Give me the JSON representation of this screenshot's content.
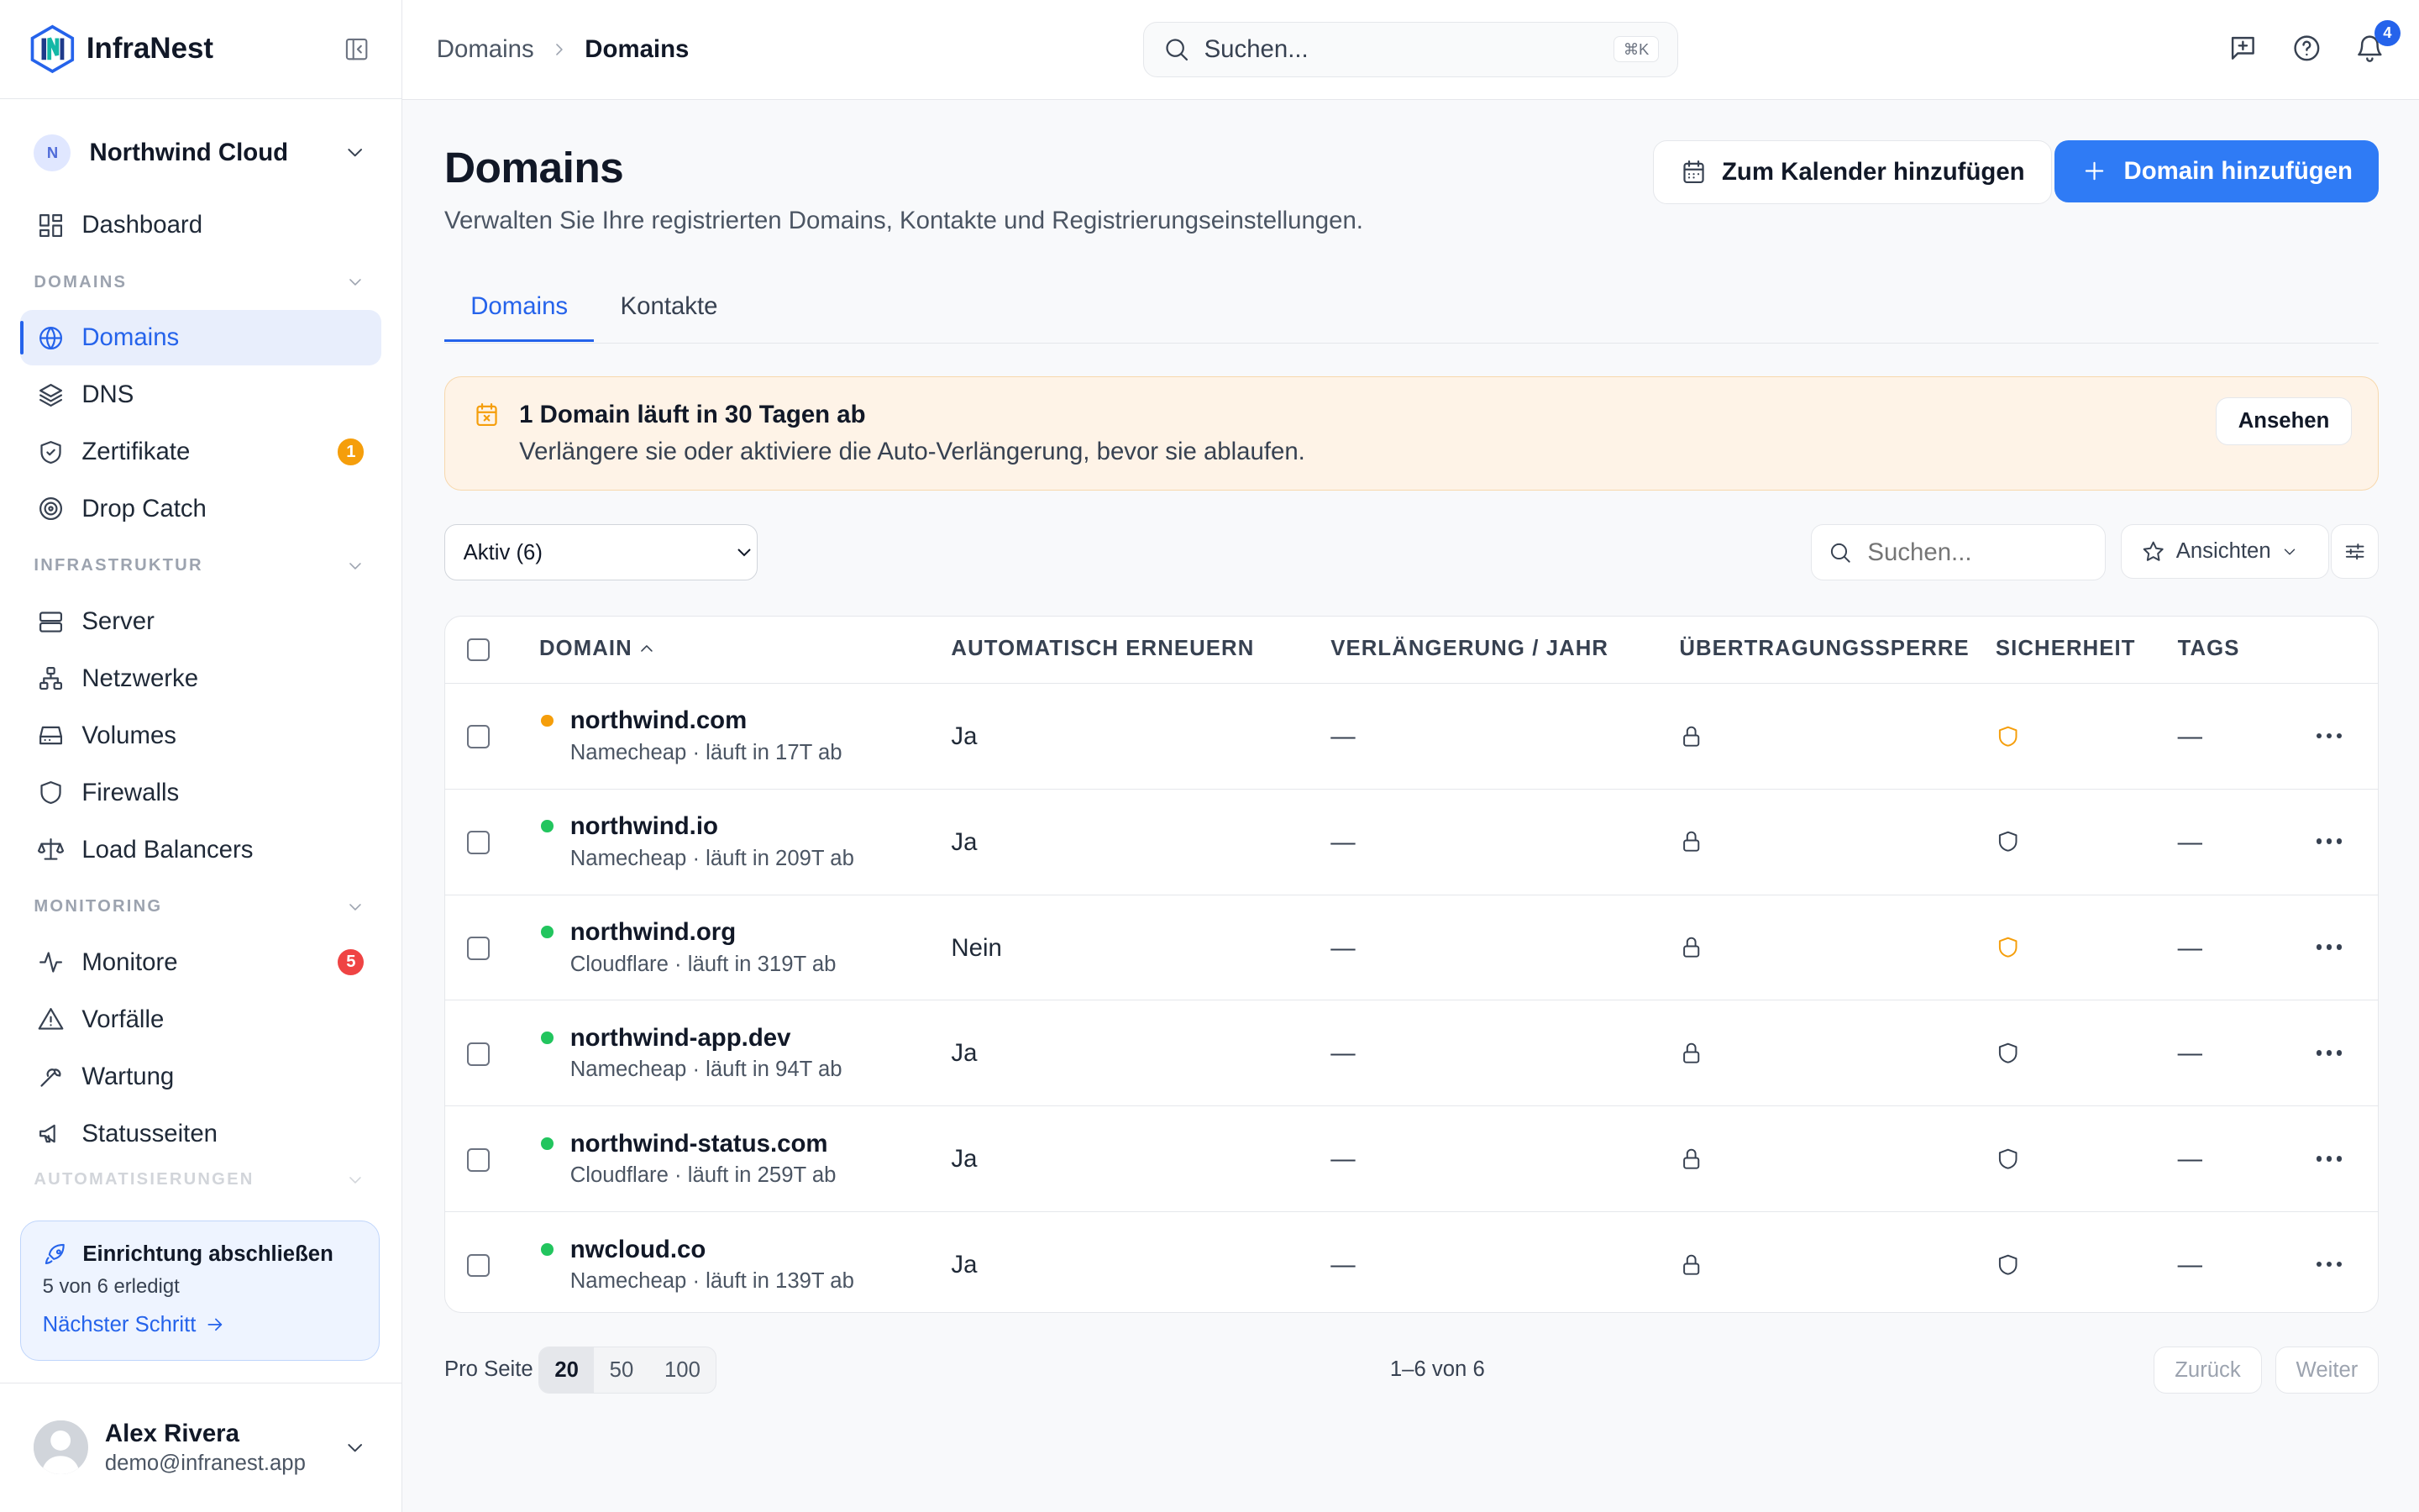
{
  "app": {
    "name": "InfraNest"
  },
  "org": {
    "initial": "N",
    "name": "Northwind Cloud"
  },
  "sidebar": {
    "dashboard": "Dashboard",
    "sections": {
      "domains": "DOMAINS",
      "infra": "INFRASTRUKTUR",
      "monitoring": "MONITORING",
      "automation": "AUTOMATISIERUNGEN"
    },
    "items": {
      "domains": "Domains",
      "dns": "DNS",
      "certs": "Zertifikate",
      "certs_badge": "1",
      "dropcatch": "Drop Catch",
      "server": "Server",
      "networks": "Netzwerke",
      "volumes": "Volumes",
      "firewalls": "Firewalls",
      "lb": "Load Balancers",
      "monitors": "Monitore",
      "monitors_badge": "5",
      "incidents": "Vorfälle",
      "maintenance": "Wartung",
      "statuspages": "Statusseiten"
    }
  },
  "setup": {
    "title": "Einrichtung abschließen",
    "progress": "5 von 6 erledigt",
    "next": "Nächster Schritt"
  },
  "user": {
    "name": "Alex Rivera",
    "email": "demo@infranest.app"
  },
  "topbar": {
    "breadcrumb_parent": "Domains",
    "breadcrumb_current": "Domains",
    "search_placeholder": "Suchen...",
    "shortcut": "⌘K",
    "notif_count": "4"
  },
  "page": {
    "title": "Domains",
    "subtitle": "Verwalten Sie Ihre registrierten Domains, Kontakte und Registrierungseinstellungen.",
    "btn_calendar": "Zum Kalender hinzufügen",
    "btn_add": "Domain hinzufügen",
    "tabs": [
      "Domains",
      "Kontakte"
    ]
  },
  "alert": {
    "title": "1 Domain läuft in 30 Tagen ab",
    "text": "Verlängere sie oder aktiviere die Auto-Verlängerung, bevor sie ablaufen.",
    "button": "Ansehen"
  },
  "toolbar": {
    "filter_selected": "Aktiv (6)",
    "search_placeholder": "Suchen...",
    "views": "Ansichten"
  },
  "table": {
    "columns": [
      "DOMAIN",
      "AUTOMATISCH ERNEUERN",
      "VERLÄNGERUNG / JAHR",
      "ÜBERTRAGUNGSSPERRE",
      "SICHERHEIT",
      "TAGS"
    ],
    "rows": [
      {
        "domain": "northwind.com",
        "meta": "Namecheap · läuft in 17T ab",
        "status": "warning",
        "auto": "Ja",
        "price": "—",
        "security": "warning",
        "tags": "—"
      },
      {
        "domain": "northwind.io",
        "meta": "Namecheap · läuft in 209T ab",
        "status": "ok",
        "auto": "Ja",
        "price": "—",
        "security": "ok",
        "tags": "—"
      },
      {
        "domain": "northwind.org",
        "meta": "Cloudflare · läuft in 319T ab",
        "status": "ok",
        "auto": "Nein",
        "price": "—",
        "security": "warning",
        "tags": "—"
      },
      {
        "domain": "northwind-app.dev",
        "meta": "Namecheap · läuft in 94T ab",
        "status": "ok",
        "auto": "Ja",
        "price": "—",
        "security": "ok",
        "tags": "—"
      },
      {
        "domain": "northwind-status.com",
        "meta": "Cloudflare · läuft in 259T ab",
        "status": "ok",
        "auto": "Ja",
        "price": "—",
        "security": "ok",
        "tags": "—"
      },
      {
        "domain": "nwcloud.co",
        "meta": "Namecheap · läuft in 139T ab",
        "status": "ok",
        "auto": "Ja",
        "price": "—",
        "security": "ok",
        "tags": "—"
      }
    ]
  },
  "pagination": {
    "per_page_label": "Pro Seite",
    "options": [
      "20",
      "50",
      "100"
    ],
    "selected": "20",
    "range": "1–6 von 6",
    "prev": "Zurück",
    "next": "Weiter"
  },
  "colors": {
    "accent": "#2f7bf5",
    "status_ok": "#22c55e",
    "status_warning": "#f59e0b"
  }
}
